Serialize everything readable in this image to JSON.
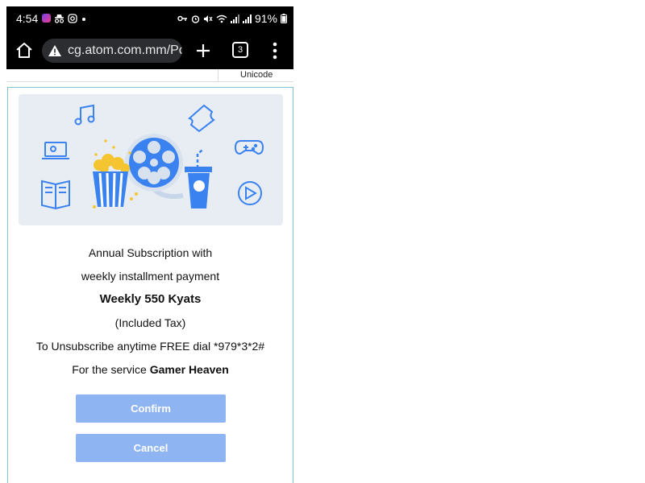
{
  "status_bar": {
    "time": "4:54",
    "battery": "91%"
  },
  "browser": {
    "url": "cg.atom.com.mm/Pc",
    "tab_count": "3"
  },
  "page": {
    "unicode_label": "Unicode",
    "line1": "Annual Subscription with",
    "line2": "weekly installment payment",
    "price": "Weekly 550 Kyats",
    "tax": "(Included Tax)",
    "unsubscribe": "To Unsubscribe anytime FREE dial *979*3*2#",
    "service_prefix": "For the service",
    "service_name": "Gamer Heaven",
    "confirm_label": "Confirm",
    "cancel_label": "Cancel"
  },
  "colors": {
    "accent_button": "#8fb4f2",
    "card_border": "#7ec2d8",
    "illustration_blue": "#3a82f0",
    "illustration_yellow": "#f5c531"
  }
}
